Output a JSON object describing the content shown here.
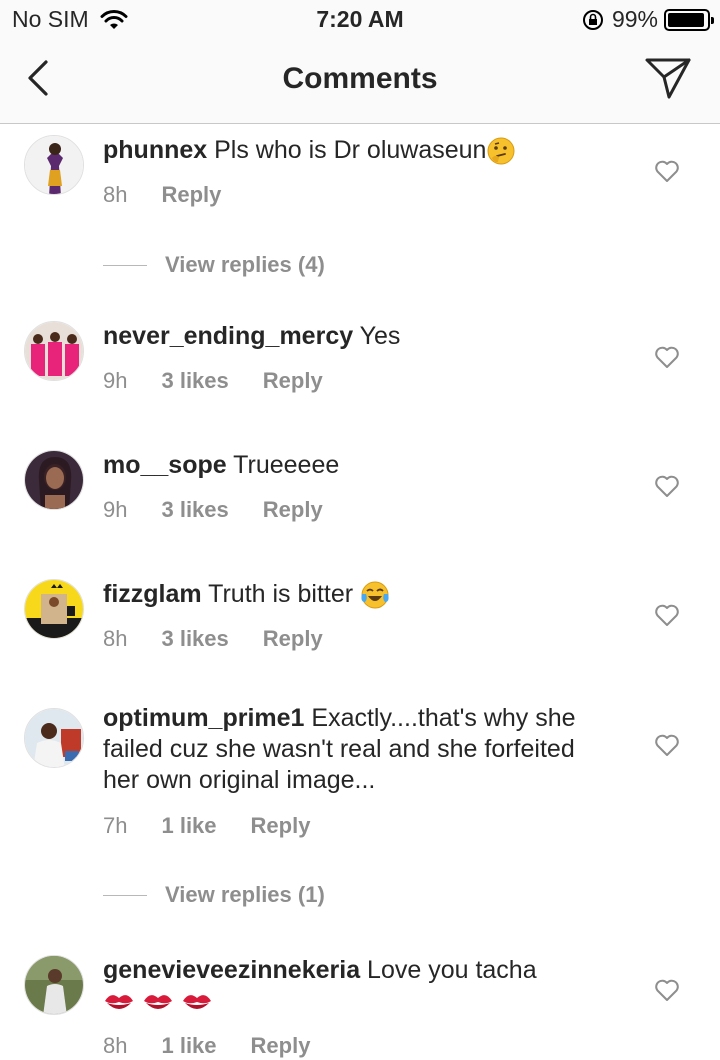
{
  "status_bar": {
    "carrier": "No SIM",
    "time": "7:20 AM",
    "battery": "99%"
  },
  "nav": {
    "title": "Comments"
  },
  "comments": [
    {
      "username": "phunnex",
      "text": "Pls who is Dr oluwaseun",
      "emoji": "thinking-face",
      "time": "8h",
      "likes": "",
      "reply": "Reply",
      "view_replies": "View replies (4)"
    },
    {
      "username": "never_ending_mercy",
      "text": "Yes",
      "time": "9h",
      "likes": "3 likes",
      "reply": "Reply"
    },
    {
      "username": "mo__sope",
      "text": "Trueeeee",
      "time": "9h",
      "likes": "3 likes",
      "reply": "Reply"
    },
    {
      "username": "fizzglam",
      "text": "Truth is bitter",
      "emoji": "tears-of-joy",
      "time": "8h",
      "likes": "3 likes",
      "reply": "Reply"
    },
    {
      "username": "optimum_prime1",
      "text": "Exactly....that's why she failed cuz she wasn't real and she forfeited her own original image...",
      "time": "7h",
      "likes": "1 like",
      "reply": "Reply",
      "view_replies": "View replies (1)"
    },
    {
      "username": "genevieveezinnekeria",
      "text": "Love you tacha",
      "emoji": "kiss-mark x3",
      "time": "8h",
      "likes": "1 like",
      "reply": "Reply"
    }
  ],
  "icons": {
    "back": "chevron-left-icon",
    "send": "paper-plane-icon",
    "like": "heart-outline-icon",
    "wifi": "wifi-icon",
    "orientation_lock": "lock-rotation-icon",
    "battery": "battery-icon"
  },
  "colors": {
    "primary_text": "#262626",
    "secondary_text": "#8e8e8e",
    "bar_bg": "#fafafa",
    "divider": "#c8c8c8"
  }
}
